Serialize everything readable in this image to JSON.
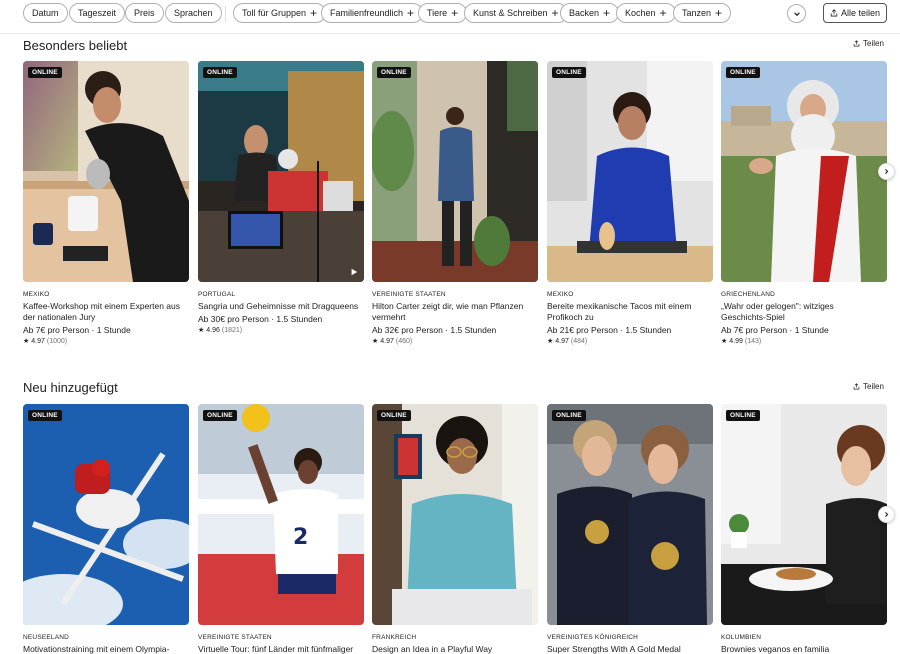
{
  "filters": {
    "chips": [
      "Datum",
      "Tageszeit",
      "Preis",
      "Sprachen"
    ],
    "categories": [
      "Toll für Gruppen",
      "Familienfreundlich",
      "Tiere",
      "Kunst & Schreiben",
      "Backen",
      "Kochen",
      "Tanzen"
    ],
    "share_all": "Alle teilen"
  },
  "sections": [
    {
      "title": "Besonders beliebt",
      "share": "Teilen",
      "cards": [
        {
          "badge": "ONLINE",
          "country": "MEXIKO",
          "title_lines": [
            "Kaffee-Workshop mit einem Experten aus",
            "der nationalen Jury"
          ],
          "price": "Ab 7€ pro Person · 1 Stunde",
          "rating": "4.97",
          "count": "(1000)"
        },
        {
          "badge": "ONLINE",
          "country": "PORTUGAL",
          "title_lines": [
            "Sangria und Geheimnisse mit Dragqueens",
            ""
          ],
          "price": "Ab 30€ pro Person · 1.5 Stunden",
          "rating": "4.96",
          "count": "(1821)"
        },
        {
          "badge": "ONLINE",
          "country": "VEREINIGTE STAATEN",
          "title_lines": [
            "Hilton Carter zeigt dir, wie man Pflanzen",
            "vermehrt"
          ],
          "price": "Ab 32€ pro Person · 1.5 Stunden",
          "rating": "4.97",
          "count": "(460)"
        },
        {
          "badge": "ONLINE",
          "country": "MEXIKO",
          "title_lines": [
            "Bereite mexikanische Tacos mit einem",
            "Profikoch zu"
          ],
          "price": "Ab 21€ pro Person · 1.5 Stunden",
          "rating": "4.97",
          "count": "(484)"
        },
        {
          "badge": "ONLINE",
          "country": "GRIECHENLAND",
          "title_lines": [
            "„Wahr oder gelogen\": witziges",
            "Geschichts-Spiel"
          ],
          "price": "Ab 7€ pro Person · 1 Stunde",
          "rating": "4.99",
          "count": "(143)"
        }
      ]
    },
    {
      "title": "Neu hinzugefügt",
      "share": "Teilen",
      "cards": [
        {
          "badge": "ONLINE",
          "country": "NEUSEELAND",
          "title_lines": [
            "Motivationstraining mit einem Olympia-"
          ]
        },
        {
          "badge": "ONLINE",
          "country": "VEREINIGTE STAATEN",
          "title_lines": [
            "Virtuelle Tour: fünf Länder mit fünfmaliger"
          ]
        },
        {
          "badge": "ONLINE",
          "country": "FRANKREICH",
          "title_lines": [
            "Design an Idea in a Playful Way"
          ]
        },
        {
          "badge": "ONLINE",
          "country": "VEREINIGTES KÖNIGREICH",
          "title_lines": [
            "Super Strengths With A Gold Medal"
          ]
        },
        {
          "badge": "ONLINE",
          "country": "KOLUMBIEN",
          "title_lines": [
            "Brownies veganos en familia"
          ]
        }
      ]
    }
  ]
}
